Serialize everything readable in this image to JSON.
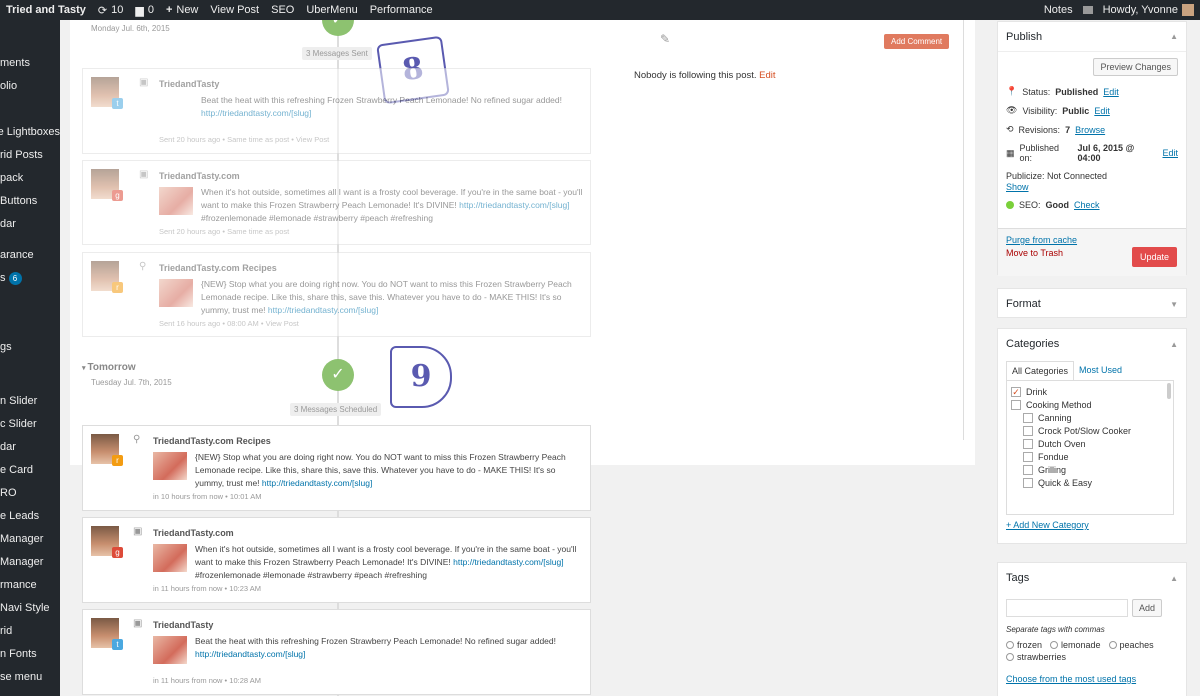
{
  "adminbar": {
    "site_title": "Tried and Tasty",
    "updates_count": "10",
    "comments_count": "0",
    "new_label": "New",
    "view_post": "View Post",
    "seo": "SEO",
    "ubermenu": "UberMenu",
    "performance": "Performance",
    "notes": "Notes",
    "howdy": "Howdy, Yvonne"
  },
  "sidebar": {
    "items": [
      {
        "label": "ments"
      },
      {
        "label": "olio"
      },
      {
        "label": "e Lightboxes"
      },
      {
        "label": "rid Posts"
      },
      {
        "label": "pack"
      },
      {
        "label": "Buttons"
      },
      {
        "label": "dar"
      },
      {
        "label": "arance"
      },
      {
        "label": "s",
        "badge": "6"
      },
      {
        "label": "gs"
      },
      {
        "label": "n Slider"
      },
      {
        "label": "c Slider"
      },
      {
        "label": "dar"
      },
      {
        "label": "e Card"
      },
      {
        "label": "RO"
      },
      {
        "label": "e Leads"
      },
      {
        "label": "Manager"
      },
      {
        "label": "Manager"
      },
      {
        "label": "rmance"
      },
      {
        "label": "Navi Style"
      },
      {
        "label": "rid"
      },
      {
        "label": "n Fonts"
      },
      {
        "label": "se menu"
      }
    ]
  },
  "timeline": {
    "day1_date": "Monday Jul. 6th, 2015",
    "day1_count": "3 Messages Sent",
    "day2_label": "Tomorrow",
    "day2_date": "Tuesday Jul. 7th, 2015",
    "day2_count": "3 Messages Scheduled",
    "callout_8": "8",
    "callout_9": "9",
    "follow_text": "Nobody is following this post.",
    "follow_edit": "Edit",
    "add_comment": "Add Comment",
    "cards": [
      {
        "name": "TriedandTasty",
        "text": "Beat the heat with this refreshing Frozen Strawberry Peach Lemonade! No refined sugar added!",
        "link": "http://triedandtasty.com/[slug]",
        "time": "Sent 20 hours ago • Same time as post • View Post",
        "network": "twitter",
        "kind": "image"
      },
      {
        "name": "TriedandTasty.com",
        "text": "When it's hot outside, sometimes all I want is a frosty cool beverage. If you're in the same boat - you'll want to make this Frozen Strawberry Peach Lemonade! It's DIVINE!",
        "link": "http://triedandtasty.com/[slug]",
        "tags": "#frozenlemonade #lemonade #strawberry #peach #refreshing",
        "time": "Sent 20 hours ago • Same time as post",
        "network": "google",
        "kind": "image"
      },
      {
        "name": "TriedandTasty.com Recipes",
        "text": "{NEW} Stop what you are doing right now. You do NOT want to miss this Frozen Strawberry Peach Lemonade recipe. Like this, share this, save this. Whatever you have to do - MAKE THIS! It's so yummy, trust me!",
        "link": "http://triedandtasty.com/[slug]",
        "time": "Sent 16 hours ago • 08:00 AM • View Post",
        "network": "rss",
        "kind": "link"
      },
      {
        "name": "TriedandTasty.com Recipes",
        "text": "{NEW} Stop what you are doing right now. You do NOT want to miss this Frozen Strawberry Peach Lemonade recipe. Like this, share this, save this. Whatever you have to do - MAKE THIS! It's so yummy, trust me!",
        "link": "http://triedandtasty.com/[slug]",
        "time": "in 10 hours from now • 10:01 AM",
        "network": "rss",
        "kind": "link"
      },
      {
        "name": "TriedandTasty.com",
        "text": "When it's hot outside, sometimes all I want is a frosty cool beverage. If you're in the same boat - you'll want to make this Frozen Strawberry Peach Lemonade! It's DIVINE!",
        "link": "http://triedandtasty.com/[slug]",
        "tags": "#frozenlemonade #lemonade #strawberry #peach #refreshing",
        "time": "in 11 hours from now • 10:23 AM",
        "network": "google",
        "kind": "image"
      },
      {
        "name": "TriedandTasty",
        "text": "Beat the heat with this refreshing Frozen Strawberry Peach Lemonade! No refined sugar added!",
        "link": "http://triedandtasty.com/[slug]",
        "time": "in 11 hours from now • 10:28 AM",
        "network": "twitter",
        "kind": "image"
      }
    ]
  },
  "publish": {
    "title": "Publish",
    "preview": "Preview Changes",
    "status_label": "Status:",
    "status_value": "Published",
    "visibility_label": "Visibility:",
    "visibility_value": "Public",
    "revisions_label": "Revisions:",
    "revisions_value": "7",
    "browse": "Browse",
    "published_label": "Published on:",
    "published_value": "Jul 6, 2015 @ 04:00",
    "edit": "Edit",
    "publicize": "Publicize: Not Connected",
    "show": "Show",
    "seo_label": "SEO:",
    "seo_value": "Good",
    "check": "Check",
    "purge": "Purge from cache",
    "trash": "Move to Trash",
    "update": "Update"
  },
  "format": {
    "title": "Format"
  },
  "categories": {
    "title": "Categories",
    "tab_all": "All Categories",
    "tab_used": "Most Used",
    "items": [
      {
        "label": "Drink",
        "checked": true,
        "indent": false
      },
      {
        "label": "Cooking Method",
        "checked": false,
        "indent": false
      },
      {
        "label": "Canning",
        "checked": false,
        "indent": true
      },
      {
        "label": "Crock Pot/Slow Cooker",
        "checked": false,
        "indent": true
      },
      {
        "label": "Dutch Oven",
        "checked": false,
        "indent": true
      },
      {
        "label": "Fondue",
        "checked": false,
        "indent": true
      },
      {
        "label": "Grilling",
        "checked": false,
        "indent": true
      },
      {
        "label": "Quick & Easy",
        "checked": false,
        "indent": true
      }
    ],
    "add_new": "+ Add New Category"
  },
  "tags": {
    "title": "Tags",
    "add": "Add",
    "hint": "Separate tags with commas",
    "items": [
      "frozen",
      "lemonade",
      "peaches",
      "strawberries"
    ],
    "choose": "Choose from the most used tags"
  },
  "colors": {
    "accent": "#0073aa",
    "check_green": "#8dc270",
    "update_red": "#e24b4b",
    "adminbar": "#23282d"
  }
}
